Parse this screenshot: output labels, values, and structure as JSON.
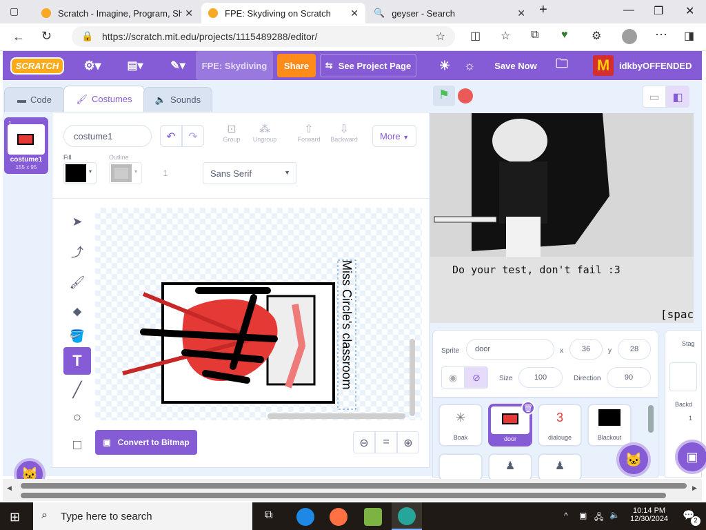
{
  "browser": {
    "tabs": [
      {
        "title": "Scratch - Imagine, Program, Share"
      },
      {
        "title": "FPE: Skydiving on Scratch"
      },
      {
        "title": "geyser - Search"
      }
    ],
    "url": "https://scratch.mit.edu/projects/1115489288/editor/"
  },
  "menu": {
    "logo": "SCRATCH",
    "project_title": "FPE: Skydiving",
    "share": "Share",
    "see_project_page": "See Project Page",
    "save_now": "Save Now",
    "username": "idkbyOFFENDED"
  },
  "editor_tabs": {
    "code": "Code",
    "costumes": "Costumes",
    "sounds": "Sounds"
  },
  "costume_list": [
    {
      "index": "1",
      "name": "costume1",
      "size": "155 x 95"
    }
  ],
  "paint": {
    "costume_name": "costume1",
    "group": "Group",
    "ungroup": "Ungroup",
    "forward": "Forward",
    "backward": "Backward",
    "more": "More",
    "fill_label": "Fill",
    "outline_label": "Outline",
    "outline_width": "1",
    "font": "Sans Serif",
    "canvas_text": "Miss Circle's classroom",
    "convert": "Convert to Bitmap"
  },
  "stage": {
    "dialogue": "Do your test, don't fail :3",
    "hint": "[space"
  },
  "sprite_info": {
    "sprite_label": "Sprite",
    "sprite_name": "door",
    "x_label": "x",
    "x": "36",
    "y_label": "y",
    "y": "28",
    "size_label": "Size",
    "size": "100",
    "direction_label": "Direction",
    "direction": "90"
  },
  "sprites": [
    {
      "name": "Boak"
    },
    {
      "name": "door"
    },
    {
      "name": "dialouge",
      "badge": "3"
    },
    {
      "name": "Blackout"
    }
  ],
  "stage_panel": {
    "title": "Stag",
    "backdrops": "Backd",
    "count": "1"
  },
  "taskbar": {
    "search": "Type here to search",
    "time": "10:14 PM",
    "date": "12/30/2024",
    "notifications": "2"
  },
  "colors": {
    "scratch_purple": "#855cd6",
    "share_orange": "#ff8c1a",
    "green_flag": "#4cbf56",
    "stop_red": "#ec5959"
  }
}
